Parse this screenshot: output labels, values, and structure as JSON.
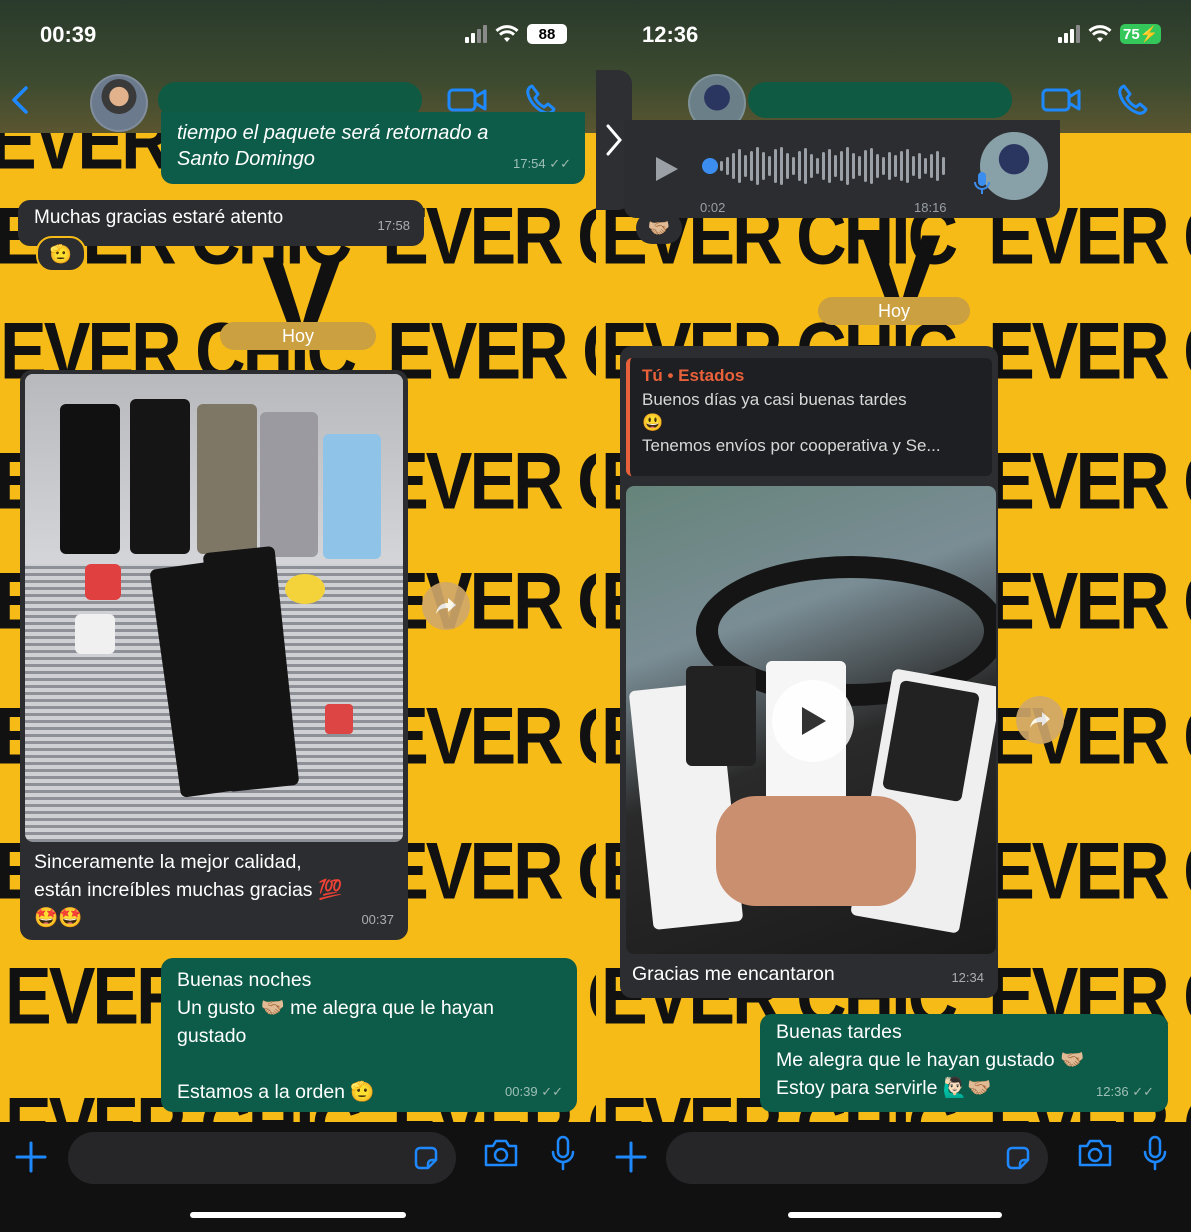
{
  "left": {
    "status_time": "00:39",
    "battery": "88",
    "wallpaper_text": "EVER CHIC",
    "wallpaper_partial": "EVER C",
    "messages": {
      "out_top": {
        "line1": "tiempo el paquete será retornado a",
        "line2": "Santo Domingo",
        "time": "17:54"
      },
      "in_thanks": {
        "text": "Muchas gracias estaré atento",
        "time": "17:58",
        "reaction": "🫡"
      },
      "date_pill": "Hoy",
      "in_photo": {
        "line1": "Sinceramente la mejor calidad,",
        "line2": "están increíbles muchas gracias 💯",
        "line3": "🤩🤩",
        "time": "00:37"
      },
      "out_reply": {
        "line1": "Buenas noches",
        "line2": "Un gusto 🤝🏼 me alegra que le hayan",
        "line3": "gustado",
        "line4": "Estamos a la orden 🫡",
        "time": "00:39"
      }
    }
  },
  "right": {
    "status_time": "12:36",
    "battery": "75",
    "wallpaper_text": "EVER CHIC",
    "voice": {
      "elapsed": "0:02",
      "time": "18:16",
      "reaction": "🤝🏼"
    },
    "date_pill": "Hoy",
    "quote": {
      "author": "Tú • Estados",
      "line1": "Buenos días ya casi buenas tardes",
      "line2": "😃",
      "line3": "Tenemos envíos por cooperativa y Se..."
    },
    "in_video": {
      "caption": "Gracias me encantaron",
      "time": "12:34"
    },
    "out_reply": {
      "line1": "Buenas tardes",
      "line2": " Me alegra que le hayan gustado 🤝🏼",
      "line3": "Estoy para servirle 🙋🏻‍♂️🤝🏼",
      "time": "12:36"
    }
  },
  "icons": {
    "back": "chevron-left-icon",
    "video": "video-camera-icon",
    "phone": "phone-icon",
    "plus": "plus-icon",
    "sticker": "sticker-icon",
    "camera": "camera-icon",
    "mic": "microphone-icon",
    "forward": "forward-icon",
    "play": "play-icon"
  },
  "colors": {
    "accent": "#1e89ff",
    "wallpaper": "#f6bb17",
    "incoming_bubble": "#2b2d31",
    "outgoing_bubble": "#0c5c49",
    "quote_author": "#e8613a"
  }
}
